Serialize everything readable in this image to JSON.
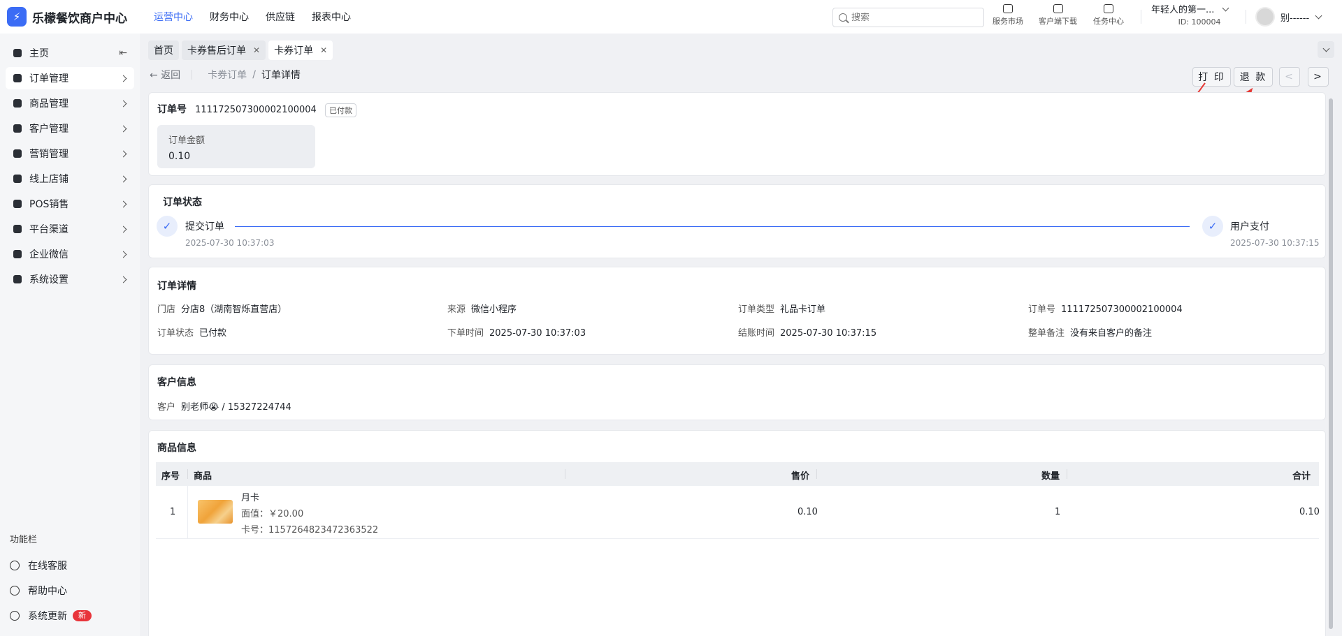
{
  "app": {
    "logo_text": "乐檬餐饮商户中心",
    "logo_mark": "⚡"
  },
  "topnav": [
    {
      "label": "运营中心",
      "active": true
    },
    {
      "label": "财务中心",
      "active": false
    },
    {
      "label": "供应链",
      "active": false
    },
    {
      "label": "报表中心",
      "active": false
    }
  ],
  "search": {
    "placeholder": "搜索"
  },
  "tools": {
    "market": "服务市场",
    "client_download": "客户端下载",
    "task_center": "任务中心"
  },
  "shop": {
    "name": "年轻人的第一...",
    "id": "ID: 100004"
  },
  "user": {
    "name": "别------"
  },
  "sidebar": {
    "items": [
      {
        "label": "主页"
      },
      {
        "label": "订单管理"
      },
      {
        "label": "商品管理"
      },
      {
        "label": "客户管理"
      },
      {
        "label": "营销管理"
      },
      {
        "label": "线上店铺"
      },
      {
        "label": "POS销售"
      },
      {
        "label": "平台渠道"
      },
      {
        "label": "企业微信"
      },
      {
        "label": "系统设置"
      }
    ],
    "function_title": "功能栏",
    "footer": [
      {
        "label": "在线客服"
      },
      {
        "label": "帮助中心"
      },
      {
        "label": "系统更新"
      }
    ],
    "new_badge": "新"
  },
  "tabs": [
    {
      "label": "首页",
      "closable": false,
      "active": false
    },
    {
      "label": "卡券售后订单",
      "closable": true,
      "active": false
    },
    {
      "label": "卡券订单",
      "closable": true,
      "active": true
    }
  ],
  "breadcrumb": {
    "back": "返回",
    "parent": "卡券订单",
    "separator": "/",
    "current": "订单详情"
  },
  "actions": {
    "print": "打 印",
    "refund": "退 款",
    "prev": "<",
    "next": ">"
  },
  "order_summary": {
    "label": "订单号",
    "number": "111172507300002100004",
    "status": "已付款",
    "amount_label": "订单金额",
    "amount_value": "0.10"
  },
  "order_status": {
    "title": "订单状态",
    "steps": [
      {
        "label": "提交订单",
        "time": "2025-07-30 10:37:03"
      },
      {
        "label": "用户支付",
        "time": "2025-07-30 10:37:15"
      }
    ]
  },
  "order_details": {
    "title": "订单详情",
    "fields": [
      {
        "key": "门店",
        "value": "分店8（湖南智烁直营店）"
      },
      {
        "key": "来源",
        "value": "微信小程序"
      },
      {
        "key": "订单类型",
        "value": "礼品卡订单"
      },
      {
        "key": "订单号",
        "value": "111172507300002100004"
      },
      {
        "key": "订单状态",
        "value": "已付款"
      },
      {
        "key": "下单时间",
        "value": "2025-07-30 10:37:03"
      },
      {
        "key": "结账时间",
        "value": "2025-07-30 10:37:15"
      },
      {
        "key": "整单备注",
        "value": "没有来自客户的备注"
      }
    ]
  },
  "customer": {
    "title": "客户信息",
    "key": "客户",
    "value": "别老师😭 / 15327224744"
  },
  "goods": {
    "title": "商品信息",
    "columns": [
      "序号",
      "商品",
      "售价",
      "数量",
      "合计"
    ],
    "rows": [
      {
        "index": "1",
        "name": "月卡",
        "face_value": "面值：￥20.00",
        "card_no": "卡号：1157264823472363522",
        "price": "0.10",
        "qty": "1",
        "total": "0.10"
      }
    ]
  }
}
